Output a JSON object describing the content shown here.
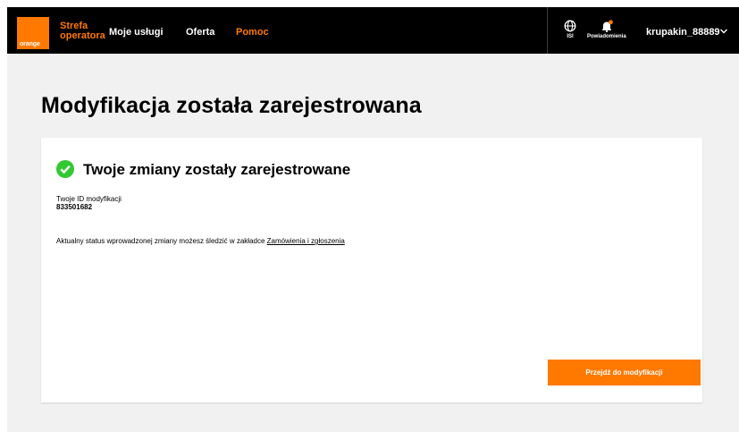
{
  "brand": {
    "logo_text": "orange",
    "line1": "Strefa",
    "line2": "operatora",
    "color": "#ff7900"
  },
  "nav": [
    {
      "label": "Moje usługi"
    },
    {
      "label": "Oferta"
    },
    {
      "label": "Pomoc"
    }
  ],
  "utilities": {
    "language": {
      "icon": "globe-icon",
      "label": "ISI"
    },
    "notifications": {
      "icon": "bell-icon",
      "label": "Powiadomienia",
      "dot_color": "#ff7900"
    }
  },
  "user": {
    "name": "krupakin_88889",
    "icon": "chevron-down-icon"
  },
  "page": {
    "title": "Modyfikacja została zarejestrowana"
  },
  "card": {
    "heading": "Twoje zmiany zostały zarejestrowane",
    "check_color": "#32c832",
    "id_label": "Twoje ID modyfikacji",
    "id_value": "833501682",
    "status_text": "Aktualny status wprowadzonej zmiany możesz śledzić w zakładce",
    "status_link": "Zamówienia i zgłoszenia",
    "button_label": "Przejdź do modyfikacji"
  }
}
